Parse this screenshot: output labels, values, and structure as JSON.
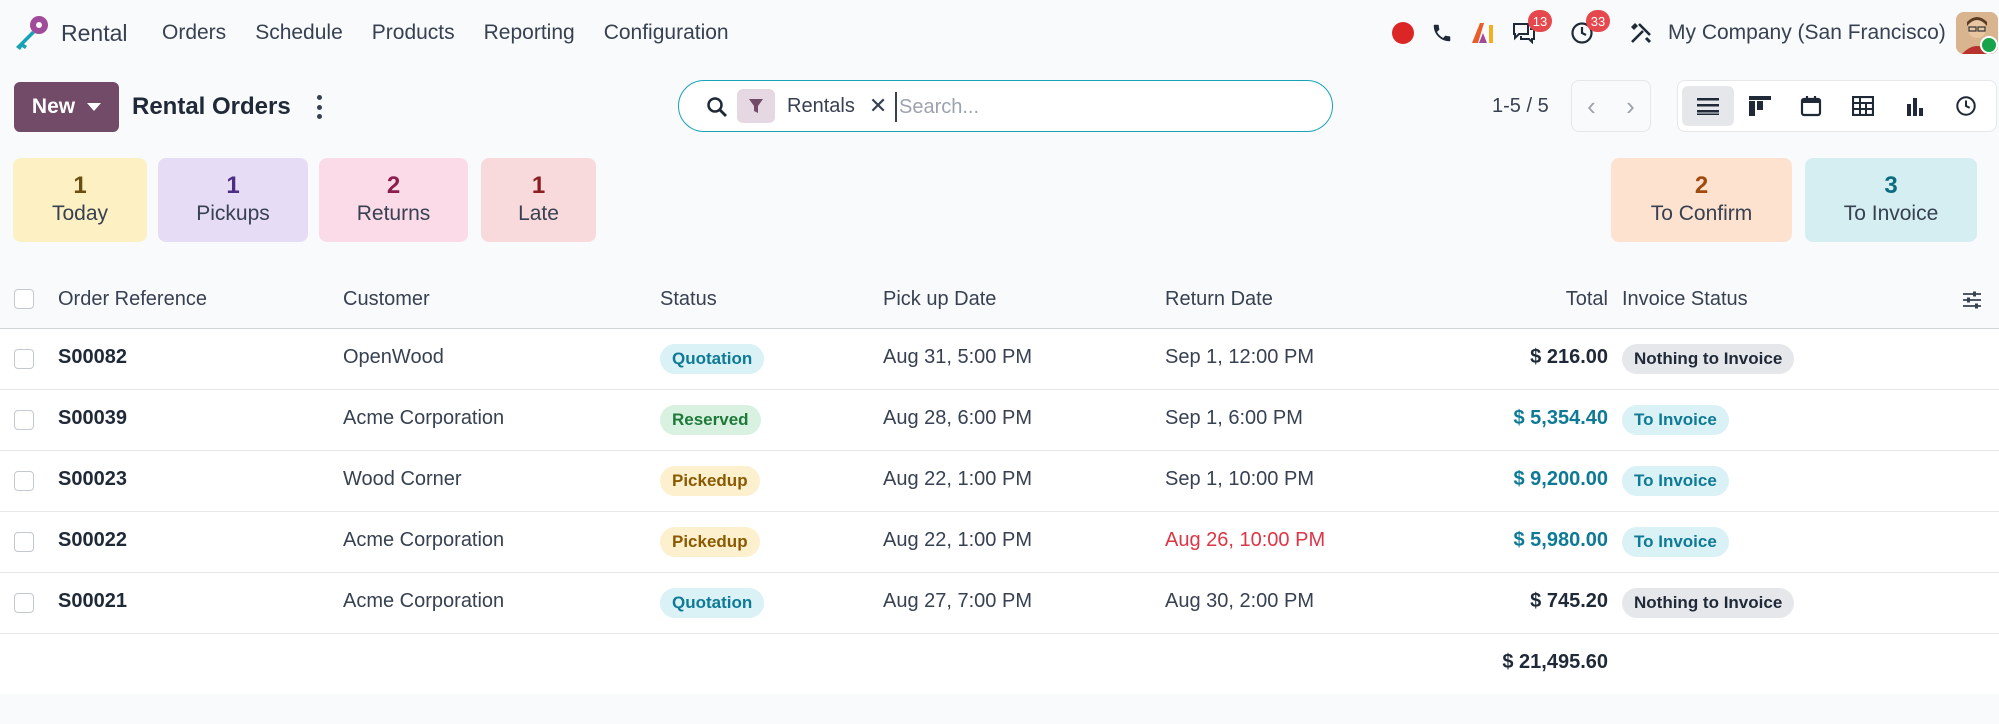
{
  "app": {
    "name": "Rental"
  },
  "menu": [
    "Orders",
    "Schedule",
    "Products",
    "Reporting",
    "Configuration"
  ],
  "systray": {
    "messages_badge": "13",
    "activities_badge": "33",
    "company": "My Company (San Francisco)"
  },
  "control": {
    "new_label": "New",
    "title": "Rental Orders",
    "search": {
      "facet_label": "Rentals",
      "placeholder": "Search...",
      "value": ""
    },
    "pager": "1-5 / 5"
  },
  "views": [
    "list-view",
    "kanban-view",
    "calendar-view",
    "pivot-view",
    "graph-view",
    "activity-view"
  ],
  "cards_left": [
    {
      "count": "1",
      "label": "Today",
      "bg": "#fdf0c2",
      "fg": "#6b4f12"
    },
    {
      "count": "1",
      "label": "Pickups",
      "bg": "#e6dcf5",
      "fg": "#4b2d83"
    },
    {
      "count": "2",
      "label": "Returns",
      "bg": "#fcdbe8",
      "fg": "#8a1f4e"
    },
    {
      "count": "1",
      "label": "Late",
      "bg": "#f8dadc",
      "fg": "#8b1e23"
    }
  ],
  "cards_right": [
    {
      "count": "2",
      "label": "To Confirm",
      "bg": "#fde2cf",
      "fg": "#a04a0d"
    },
    {
      "count": "3",
      "label": "To Invoice",
      "bg": "#d5eef2",
      "fg": "#0b6b80"
    }
  ],
  "table": {
    "headers": {
      "ref": "Order Reference",
      "customer": "Customer",
      "status": "Status",
      "pickup": "Pick up Date",
      "return": "Return Date",
      "total": "Total",
      "invoice": "Invoice Status"
    },
    "rows": [
      {
        "ref": "S00082",
        "customer": "OpenWood",
        "status": "Quotation",
        "pickup": "Aug 31, 5:00 PM",
        "return": "Sep 1, 12:00 PM",
        "total": "$ 216.00",
        "invoice": "Nothing to Invoice"
      },
      {
        "ref": "S00039",
        "customer": "Acme Corporation",
        "status": "Reserved",
        "pickup": "Aug 28, 6:00 PM",
        "return": "Sep 1, 6:00 PM",
        "total": "$ 5,354.40",
        "invoice": "To Invoice"
      },
      {
        "ref": "S00023",
        "customer": "Wood Corner",
        "status": "Pickedup",
        "pickup": "Aug 22, 1:00 PM",
        "return": "Sep 1, 10:00 PM",
        "total": "$ 9,200.00",
        "invoice": "To Invoice"
      },
      {
        "ref": "S00022",
        "customer": "Acme Corporation",
        "status": "Pickedup",
        "pickup": "Aug 22, 1:00 PM",
        "return": "Aug 26, 10:00 PM",
        "total": "$ 5,980.00",
        "invoice": "To Invoice"
      },
      {
        "ref": "S00021",
        "customer": "Acme Corporation",
        "status": "Quotation",
        "pickup": "Aug 27, 7:00 PM",
        "return": "Aug 30, 2:00 PM",
        "total": "$ 745.20",
        "invoice": "Nothing to Invoice"
      }
    ],
    "sum_total": "$ 21,495.60"
  },
  "colors": {
    "brand": "#714b67",
    "link_total": "#0e7a96",
    "late_date": "#dc3545",
    "status_quotation": {
      "bg": "#daf1f6",
      "fg": "#0e7a96"
    },
    "status_reserved": {
      "bg": "#d8f1e0",
      "fg": "#1f7a3a"
    },
    "status_pickedup": {
      "bg": "#fdf0cf",
      "fg": "#8a5a00"
    },
    "invoice_nothing": {
      "bg": "#e5e7eb",
      "fg": "#1f2937"
    },
    "invoice_to": {
      "bg": "#daf1f6",
      "fg": "#0e7a96"
    }
  }
}
